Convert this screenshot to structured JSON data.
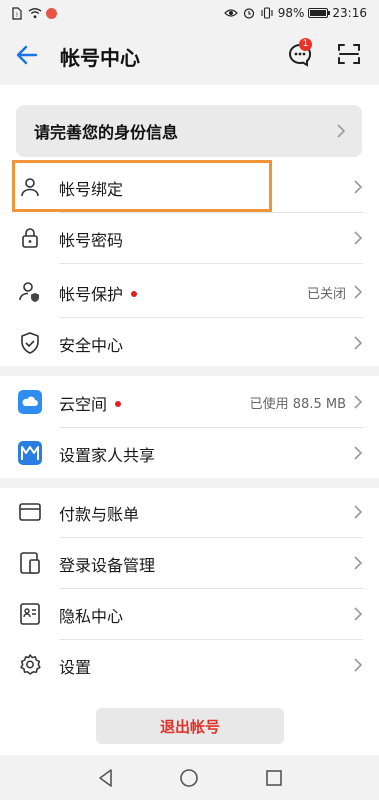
{
  "status_bar": {
    "battery": "98%",
    "battery_level": 0.98,
    "time": "23:16"
  },
  "header": {
    "title": "帐号中心",
    "message_badge": "1"
  },
  "banner": {
    "text": "请完善您的身份信息"
  },
  "menu_groups": [
    [
      {
        "label": "帐号绑定",
        "icon": "person-icon"
      },
      {
        "label": "帐号密码",
        "icon": "lock-icon"
      },
      {
        "label": "帐号保护",
        "icon": "person-shield-icon",
        "dot": true,
        "value": "已关闭"
      },
      {
        "label": "安全中心",
        "icon": "shield-check-icon"
      }
    ],
    [
      {
        "label": "云空间",
        "icon": "cloud-icon",
        "dot": true,
        "value": "已使用 88.5 MB"
      },
      {
        "label": "设置家人共享",
        "icon": "family-share-icon"
      }
    ],
    [
      {
        "label": "付款与账单",
        "icon": "card-icon"
      },
      {
        "label": "登录设备管理",
        "icon": "devices-icon"
      },
      {
        "label": "隐私中心",
        "icon": "id-card-icon"
      },
      {
        "label": "设置",
        "icon": "gear-icon"
      }
    ]
  ],
  "logout_label": "退出帐号",
  "colors": {
    "accent_blue": "#1a73e8",
    "danger_red": "#e0332a",
    "highlight_orange": "#f0953a"
  }
}
